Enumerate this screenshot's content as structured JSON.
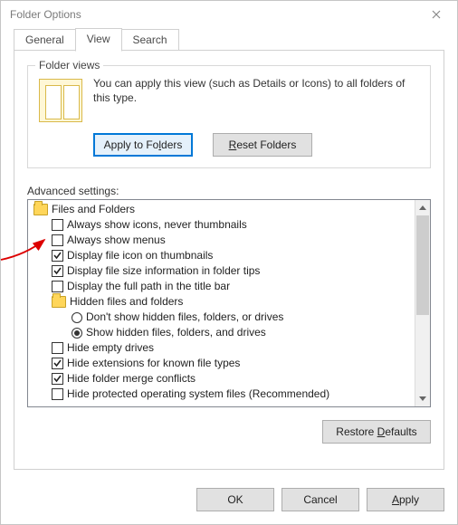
{
  "window": {
    "title": "Folder Options"
  },
  "tabs": {
    "general": "General",
    "view": "View",
    "search": "Search",
    "active": "view"
  },
  "folderViews": {
    "legend": "Folder views",
    "text": "You can apply this view (such as Details or Icons) to all folders of this type.",
    "applyBtn": {
      "pre": "Apply to Fo",
      "mn": "l",
      "post": "ders"
    },
    "resetBtn": {
      "pre": "",
      "mn": "R",
      "post": "eset Folders"
    }
  },
  "advanced": {
    "label": "Advanced settings:",
    "root": "Files and Folders",
    "items": [
      {
        "type": "check",
        "checked": false,
        "label": "Always show icons, never thumbnails"
      },
      {
        "type": "check",
        "checked": false,
        "label": "Always show menus"
      },
      {
        "type": "check",
        "checked": true,
        "label": "Display file icon on thumbnails"
      },
      {
        "type": "check",
        "checked": true,
        "label": "Display file size information in folder tips"
      },
      {
        "type": "check",
        "checked": false,
        "label": "Display the full path in the title bar"
      },
      {
        "type": "folder",
        "label": "Hidden files and folders"
      },
      {
        "type": "radio",
        "selected": false,
        "label": "Don't show hidden files, folders, or drives"
      },
      {
        "type": "radio",
        "selected": true,
        "label": "Show hidden files, folders, and drives"
      },
      {
        "type": "check",
        "checked": false,
        "label": "Hide empty drives"
      },
      {
        "type": "check",
        "checked": true,
        "label": "Hide extensions for known file types"
      },
      {
        "type": "check",
        "checked": true,
        "label": "Hide folder merge conflicts"
      },
      {
        "type": "check",
        "checked": false,
        "label": "Hide protected operating system files (Recommended)"
      }
    ]
  },
  "restoreBtn": {
    "pre": "Restore ",
    "mn": "D",
    "post": "efaults"
  },
  "footer": {
    "ok": "OK",
    "cancel": "Cancel",
    "apply": {
      "pre": "",
      "mn": "A",
      "post": "pply"
    }
  }
}
